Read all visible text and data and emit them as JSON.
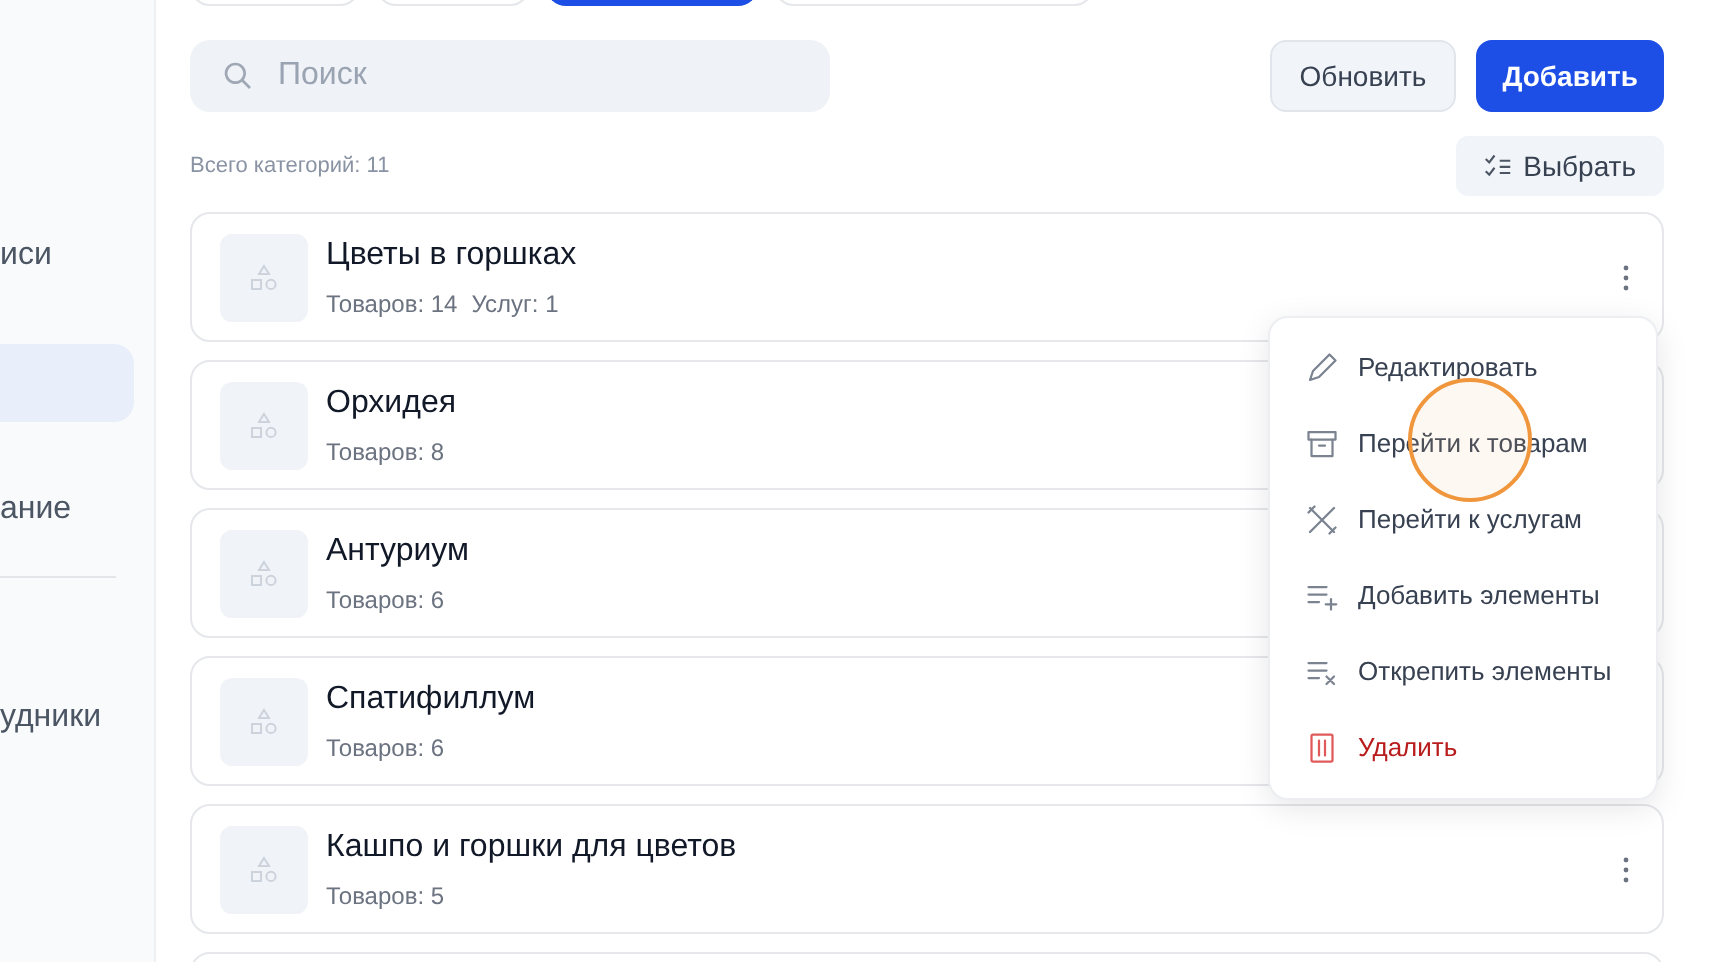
{
  "sidebar": {
    "items": [
      {
        "label": "иси",
        "selected": false
      },
      {
        "selected": true
      },
      {
        "label": "ание",
        "selected": false
      },
      {
        "label": "удники",
        "selected": false
      }
    ]
  },
  "tabs": [
    {
      "selected": false
    },
    {
      "selected": false
    },
    {
      "selected": true
    },
    {
      "selected": false
    }
  ],
  "search": {
    "placeholder": "Поиск"
  },
  "buttons": {
    "refresh": "Обновить",
    "add": "Добавить",
    "select": "Выбрать"
  },
  "total": "Всего категорий: 11",
  "categories": [
    {
      "name": "Цветы в горшках",
      "counts": [
        "Товаров: 14",
        "Услуг: 1"
      ]
    },
    {
      "name": "Орхидея",
      "counts": [
        "Товаров: 8"
      ]
    },
    {
      "name": "Антуриум",
      "counts": [
        "Товаров: 6"
      ]
    },
    {
      "name": "Спатифиллум",
      "counts": [
        "Товаров: 6"
      ]
    },
    {
      "name": "Кашпо и горшки для цветов",
      "counts": [
        "Товаров: 5"
      ]
    }
  ],
  "menu": {
    "items": [
      {
        "label": "Редактировать",
        "kind": "normal"
      },
      {
        "label": "Перейти к товарам",
        "kind": "normal"
      },
      {
        "label": "Перейти к услугам",
        "kind": "normal"
      },
      {
        "label": "Добавить элементы",
        "kind": "normal"
      },
      {
        "label": "Открепить элементы",
        "kind": "normal"
      },
      {
        "label": "Удалить",
        "kind": "danger"
      }
    ]
  }
}
